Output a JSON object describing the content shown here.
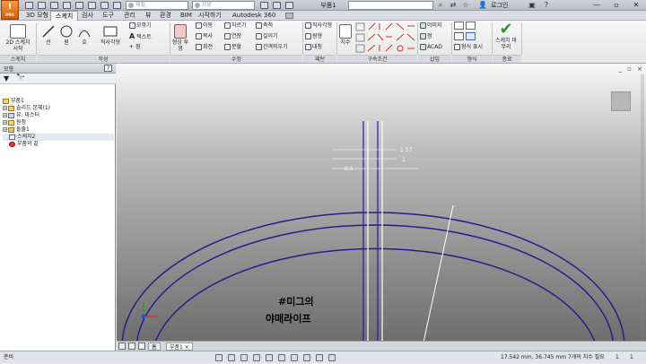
{
  "app": {
    "logo_text": "I",
    "logo_sub": "PRO",
    "quick_access": {
      "material_placeholder": "재질",
      "appearance_placeholder": "모양"
    },
    "document_title": "부품1",
    "user_login": "로그인",
    "help_glyph": "?",
    "window_controls": [
      "—",
      "▫",
      "✕"
    ]
  },
  "tabs": [
    {
      "label": "3D 모형",
      "active": false
    },
    {
      "label": "스케치",
      "active": true
    },
    {
      "label": "검사",
      "active": false
    },
    {
      "label": "도구",
      "active": false
    },
    {
      "label": "관리",
      "active": false
    },
    {
      "label": "뷰",
      "active": false
    },
    {
      "label": "환경",
      "active": false
    },
    {
      "label": "BIM",
      "active": false
    },
    {
      "label": "시작하기",
      "active": false
    },
    {
      "label": "Autodesk 360",
      "active": false
    }
  ],
  "ribbon": {
    "sketch_group": {
      "button": "2D 스케치 시작",
      "label": "스케치"
    },
    "create_group": {
      "buttons": [
        "선",
        "원",
        "호",
        "직사각형"
      ],
      "small": [
        "모깎기",
        "텍스트",
        "점"
      ],
      "label": "작성"
    },
    "modify_group": {
      "big": "형상 투영",
      "small": [
        "이동",
        "자르기",
        "축척",
        "복사",
        "연장",
        "길이기",
        "회전",
        "분할",
        "간격띄우기"
      ],
      "label": "수정"
    },
    "pattern_group": {
      "small": [
        "직사각형",
        "원형",
        "대칭"
      ],
      "label": "패턴"
    },
    "constrain_group": {
      "big": "치수",
      "label": "구속조건"
    },
    "insert_group": {
      "small": [
        "이미지",
        "점",
        "ACAD"
      ],
      "label": "삽입"
    },
    "format_group": {
      "small": [
        "형식 표시"
      ],
      "label": "형식"
    },
    "finish_group": {
      "button": "스케치 마무리",
      "label": "종료"
    }
  },
  "browser": {
    "title": "모형",
    "help": "?",
    "items": [
      {
        "label": "부품1",
        "indent": 0,
        "expander": ""
      },
      {
        "label": "솔리드 본체(1)",
        "indent": 1,
        "expander": "+"
      },
      {
        "label": "뷰: 마스터",
        "indent": 1,
        "expander": "+"
      },
      {
        "label": "원점",
        "indent": 1,
        "expander": "+"
      },
      {
        "label": "돌출1",
        "indent": 1,
        "expander": "+"
      },
      {
        "label": "스케치2",
        "indent": 1,
        "expander": ""
      },
      {
        "label": "부품의 끝",
        "indent": 1,
        "expander": ""
      }
    ]
  },
  "viewport": {
    "controls": "_ ▫ ×",
    "viewcube_label": "",
    "dims": [
      "1.57",
      "1",
      "0.5"
    ],
    "watermark_line1": "#미그의",
    "watermark_line2": "야매라이프"
  },
  "doc_tabs": {
    "home": "홈",
    "doc": "부품1"
  },
  "status": {
    "left": "준비",
    "coords": "17.542 mm, 36.745 mm",
    "dims_needed": "7개의 치수 필요",
    "page": "1",
    "count": "1"
  },
  "colors": {
    "arc": "#2b1b8c",
    "accent_tab": "#f4f4f4",
    "logo": "#e8740c"
  }
}
